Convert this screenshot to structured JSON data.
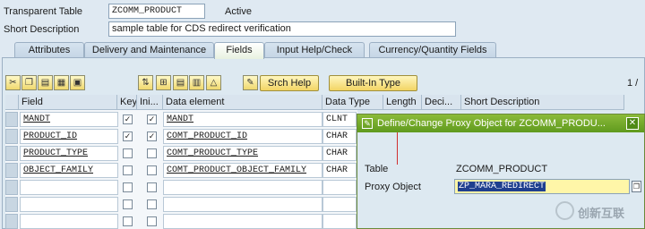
{
  "header": {
    "table_type_label": "Transparent Table",
    "table_name": "ZCOMM_PRODUCT",
    "status": "Active",
    "short_desc_label": "Short Description",
    "short_desc_value": "sample table for CDS redirect verification"
  },
  "tabs": [
    {
      "label": "Attributes"
    },
    {
      "label": "Delivery and Maintenance"
    },
    {
      "label": "Fields"
    },
    {
      "label": "Input Help/Check"
    },
    {
      "label": "Currency/Quantity Fields"
    }
  ],
  "toolbar": {
    "srch_help": "Srch Help",
    "builtin_type": "Built-In Type",
    "page_indicator": "1 /"
  },
  "columns": {
    "field": "Field",
    "key": "Key",
    "ini": "Ini...",
    "data_element": "Data element",
    "data_type": "Data Type",
    "length": "Length",
    "deci": "Deci...",
    "short_description": "Short Description"
  },
  "rows": [
    {
      "field": "MANDT",
      "key": true,
      "ini": true,
      "data_element": "MANDT",
      "data_type": "CLNT"
    },
    {
      "field": "PRODUCT_ID",
      "key": true,
      "ini": true,
      "data_element": "COMT_PRODUCT_ID",
      "data_type": "CHAR"
    },
    {
      "field": "PRODUCT_TYPE",
      "key": false,
      "ini": false,
      "data_element": "COMT_PRODUCT_TYPE",
      "data_type": "CHAR"
    },
    {
      "field": "OBJECT_FAMILY",
      "key": false,
      "ini": false,
      "data_element": "COMT_PRODUCT_OBJECT_FAMILY",
      "data_type": "CHAR"
    }
  ],
  "popup": {
    "title": "Define/Change Proxy Object for ZCOMM_PRODU...",
    "table_label": "Table",
    "table_value": "ZCOMM_PRODUCT",
    "proxy_label": "Proxy Object",
    "proxy_value": "ZP_MARA_REDIRECT"
  },
  "watermark": "创新互联",
  "colors": {
    "popup_title": "#6fa82a",
    "button_yellow": "#f2d564",
    "background": "#dfe9f2"
  }
}
